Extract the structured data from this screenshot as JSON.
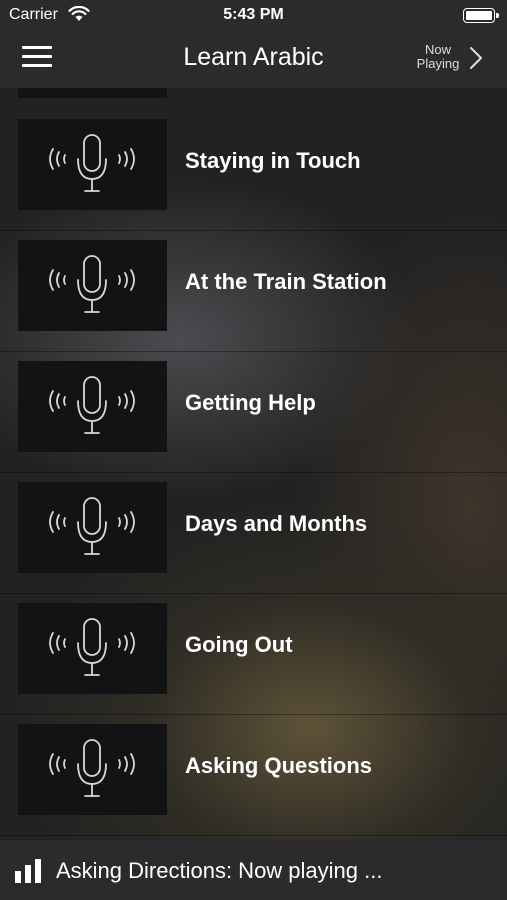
{
  "status_bar": {
    "carrier": "Carrier",
    "time": "5:43 PM"
  },
  "nav": {
    "title": "Learn Arabic",
    "now_playing_line1": "Now",
    "now_playing_line2": "Playing"
  },
  "lessons": [
    {
      "label": "Staying in Touch",
      "icon": "microphone-icon"
    },
    {
      "label": "At the Train Station",
      "icon": "microphone-icon"
    },
    {
      "label": "Getting Help",
      "icon": "microphone-icon"
    },
    {
      "label": "Days and Months",
      "icon": "microphone-icon"
    },
    {
      "label": "Going Out",
      "icon": "microphone-icon"
    },
    {
      "label": "Asking Questions",
      "icon": "microphone-icon"
    }
  ],
  "player": {
    "text": "Asking Directions: Now playing ...",
    "icon": "bars-icon"
  }
}
